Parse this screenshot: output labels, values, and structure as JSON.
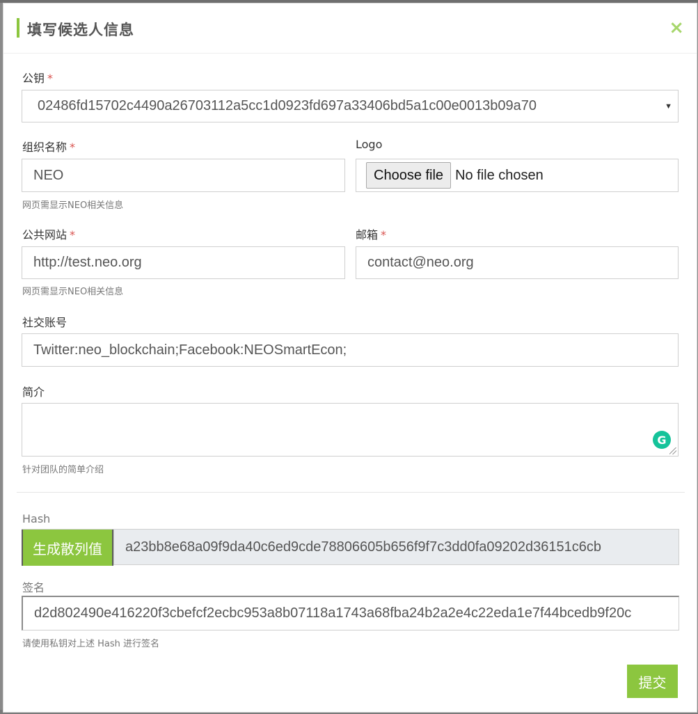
{
  "modal": {
    "title": "填写候选人信息",
    "close_glyph": "×"
  },
  "public_key": {
    "label": "公钥",
    "required_mark": "*",
    "value": "02486fd15702c4490a26703112a5cc1d0923fd697a33406bd5a1c00e0013b09a70",
    "caret": "▼"
  },
  "org_name": {
    "label": "组织名称",
    "required_mark": "*",
    "value": "NEO",
    "hint": "网页需显示NEO相关信息"
  },
  "logo": {
    "label": "Logo",
    "button_label": "Choose file",
    "status": "No file chosen"
  },
  "website": {
    "label": "公共网站",
    "required_mark": "*",
    "value": "http://test.neo.org",
    "hint": "网页需显示NEO相关信息"
  },
  "email": {
    "label": "邮箱",
    "required_mark": "*",
    "value": "contact@neo.org"
  },
  "social": {
    "label": "社交账号",
    "value": "Twitter:neo_blockchain;Facebook:NEOSmartEcon;"
  },
  "intro": {
    "label": "简介",
    "value": "",
    "hint": "针对团队的简单介绍",
    "grammarly_glyph": "G"
  },
  "hash": {
    "label": "Hash",
    "button_label": "生成散列值",
    "value": "a23bb8e68a09f9da40c6ed9cde78806605b656f9f7c3dd0fa09202d36151c6cb"
  },
  "signature": {
    "label": "签名",
    "value": "d2d802490e416220f3cbefcf2ecbc953a8b07118a1743a68fba24b2a2e4c22eda1e7f44bcedb9f20c",
    "hint": "请使用私钥对上述 Hash 进行签名"
  },
  "submit": {
    "label": "提交"
  },
  "colors": {
    "accent": "#8cc63f",
    "required": "#d9534f",
    "grammarly": "#15c39a"
  }
}
